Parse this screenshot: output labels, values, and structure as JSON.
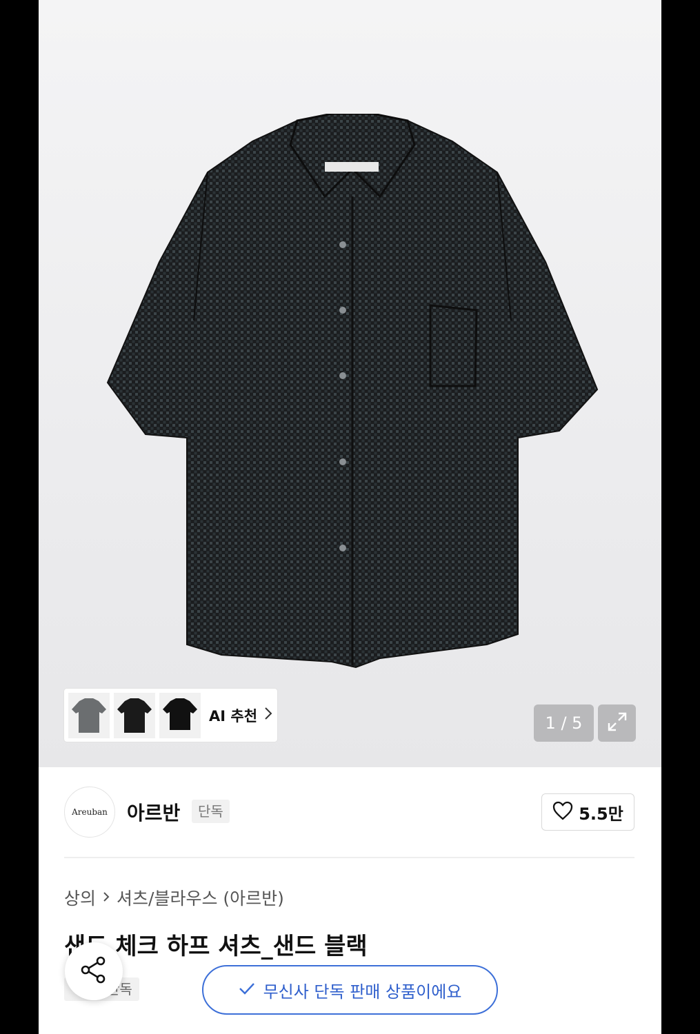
{
  "gallery": {
    "counter": "1 / 5",
    "ai_recommend_label": "AI 추천",
    "thumbnails": [
      "gray-shirt",
      "black-shirt",
      "black-shirt-2"
    ]
  },
  "brand": {
    "logo_text": "Areuban",
    "name": "아르반",
    "badge": "단독",
    "like_count": "5.5만"
  },
  "product": {
    "breadcrumb": [
      "상의",
      "셔츠/블라우스 (아르반)"
    ],
    "title": "샌드 체크 하프 셔츠_샌드 블랙",
    "tag": "단독"
  },
  "notice": {
    "label": "무신사 단독 판매 상품이에요"
  },
  "icons": {
    "heart": "heart-icon",
    "share": "share-icon",
    "expand": "expand-icon",
    "check": "check-icon",
    "chevron": "chevron-right-icon"
  },
  "colors": {
    "accent_blue": "#3c6fd8",
    "overlay_gray": "#b9b9bb"
  }
}
